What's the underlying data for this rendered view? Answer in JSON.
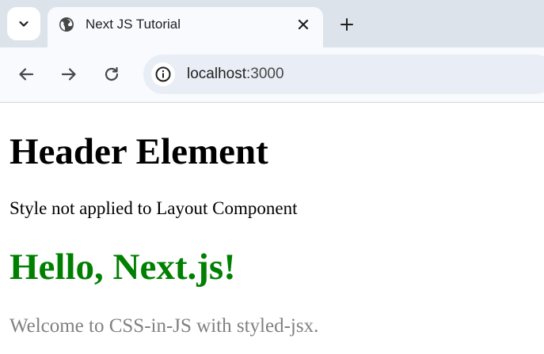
{
  "browser": {
    "tab": {
      "title": "Next JS Tutorial",
      "favicon": "globe-icon"
    },
    "icons": {
      "tab_search": "chevron-down-icon",
      "tab_close": "close-icon",
      "new_tab": "plus-icon",
      "back": "arrow-left-icon",
      "forward": "arrow-right-icon",
      "reload": "reload-icon",
      "site_info": "info-icon"
    },
    "address_bar": {
      "host": "localhost",
      "port": ":3000"
    }
  },
  "page": {
    "header": "Header Element",
    "style_note": "Style not applied to Layout Component",
    "hello": "Hello, Next.js!",
    "welcome": "Welcome to CSS-in-JS with styled-jsx."
  },
  "colors": {
    "hello_text": "#008000",
    "welcome_text": "#808080",
    "tab_strip_bg": "#dde3ea",
    "toolbar_bg": "#f8fafd",
    "omnibox_bg": "#e9eef6"
  }
}
